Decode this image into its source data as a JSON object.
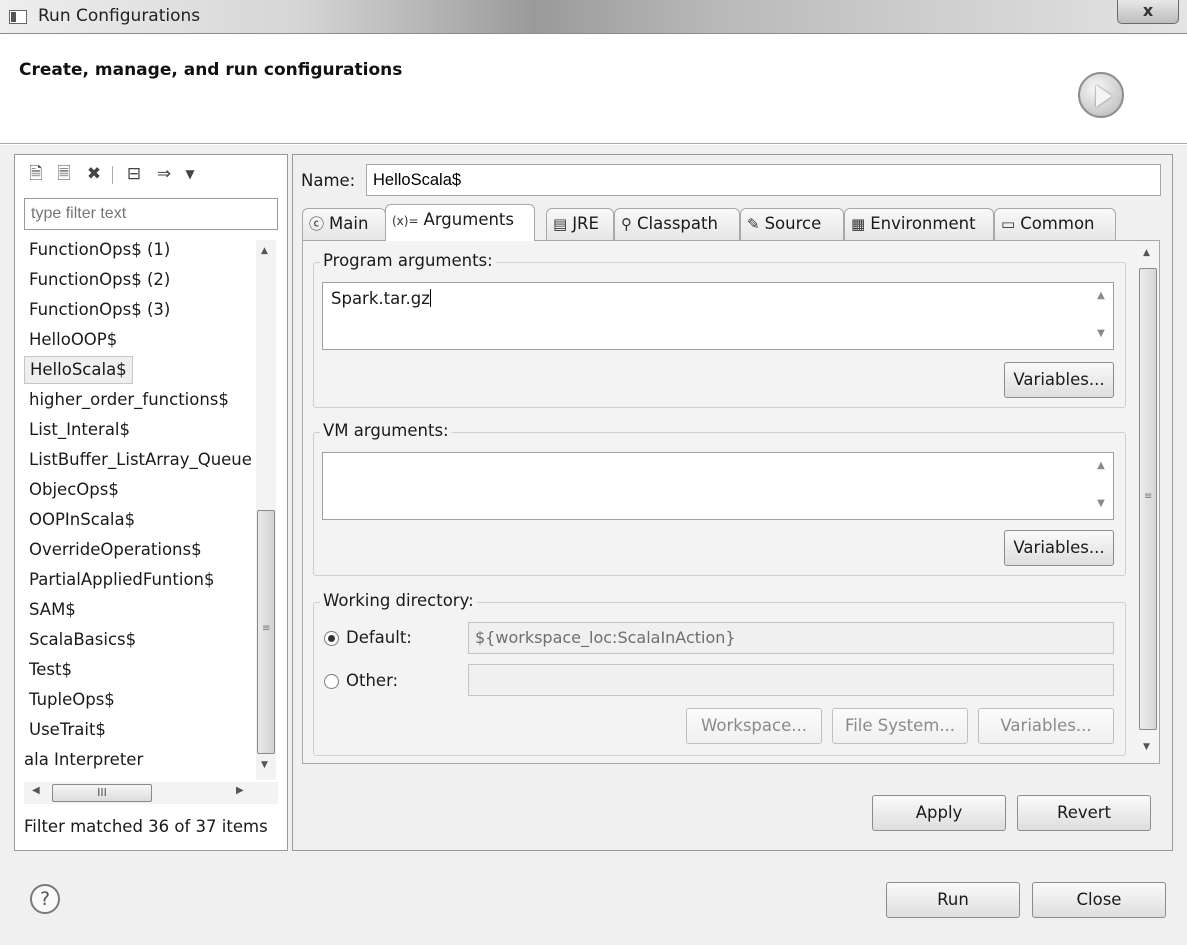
{
  "window": {
    "title": "Run Configurations",
    "close_glyph": "x"
  },
  "header": {
    "title": "Create, manage, and run configurations",
    "icon": "run-icon"
  },
  "left": {
    "toolbar_icons": [
      "new-config-icon",
      "duplicate-icon",
      "delete-icon",
      "collapse-all-icon",
      "filter-icon",
      "dropdown-icon"
    ],
    "filter_placeholder": "type filter text",
    "items": [
      "FunctionOps$ (1)",
      "FunctionOps$ (2)",
      "FunctionOps$ (3)",
      "HelloOOP$",
      "HelloScala$",
      "higher_order_functions$",
      "List_Interal$",
      "ListBuffer_ListArray_Queue",
      "ObjecOps$",
      "OOPInScala$",
      "OverrideOperations$",
      "PartialAppliedFuntion$",
      "SAM$",
      "ScalaBasics$",
      "Test$",
      "TupleOps$",
      "UseTrait$",
      "ala Interpreter"
    ],
    "selected_index": 4,
    "hscroll_thumb": "III",
    "status": "Filter matched 36 of 37 items"
  },
  "right": {
    "name_label": "Name:",
    "name_value": "HelloScala$",
    "tabs": [
      {
        "label": "Main",
        "icon": "main-tab-icon",
        "glyph": "ⓒ"
      },
      {
        "label": "Arguments",
        "icon": "arguments-tab-icon",
        "glyph": "(x)="
      },
      {
        "label": "JRE",
        "icon": "jre-tab-icon",
        "glyph": "▤"
      },
      {
        "label": "Classpath",
        "icon": "classpath-tab-icon",
        "glyph": "⚲"
      },
      {
        "label": "Source",
        "icon": "source-tab-icon",
        "glyph": "✎"
      },
      {
        "label": "Environment",
        "icon": "environment-tab-icon",
        "glyph": "▦"
      },
      {
        "label": "Common",
        "icon": "common-tab-icon",
        "glyph": "▭"
      }
    ],
    "active_tab": 1,
    "program_args": {
      "label": "Program arguments:",
      "value": "Spark.tar.gz",
      "variables_button": "Variables..."
    },
    "vm_args": {
      "label": "VM arguments:",
      "value": "",
      "variables_button": "Variables..."
    },
    "working_dir": {
      "label": "Working directory:",
      "default_label": "Default:",
      "default_value": "${workspace_loc:ScalaInAction}",
      "other_label": "Other:",
      "other_value": "",
      "selected": "default",
      "workspace_button": "Workspace...",
      "filesystem_button": "File System...",
      "variables_button": "Variables..."
    },
    "apply_button": "Apply",
    "revert_button": "Revert"
  },
  "footer": {
    "help_glyph": "?",
    "run_button": "Run",
    "close_button": "Close"
  }
}
